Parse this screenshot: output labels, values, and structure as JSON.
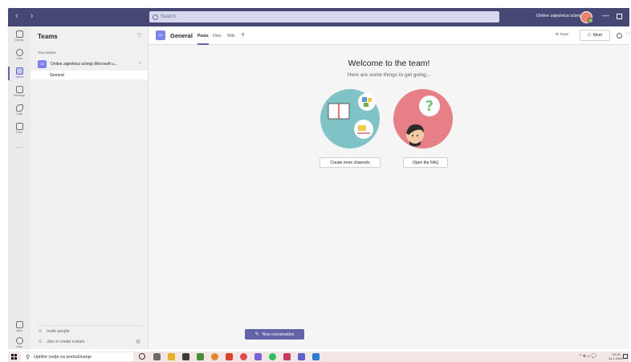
{
  "titlebar": {
    "nav": "‹ ›",
    "search_placeholder": "Search",
    "org_name": "Online zajednica učenja",
    "minimize": "—"
  },
  "rail": {
    "items": [
      {
        "label": "Activity",
        "icon": "bell-icon"
      },
      {
        "label": "Chat",
        "icon": "chat-icon"
      },
      {
        "label": "Teams",
        "icon": "teams-icon",
        "active": true
      },
      {
        "label": "Meetings",
        "icon": "calendar-icon"
      },
      {
        "label": "Calls",
        "icon": "phone-icon"
      },
      {
        "label": "Files",
        "icon": "file-icon"
      }
    ],
    "more": "···",
    "apps_label": "Apps",
    "help_label": "Help"
  },
  "teams_panel": {
    "title": "Teams",
    "section": "Your teams",
    "team": {
      "badge": "OZ",
      "name": "Online zajednica učenja Microsoft u..."
    },
    "channel": "General",
    "invite": "Invite people",
    "join": "Join or create a team"
  },
  "channel_header": {
    "badge": "OZ",
    "title": "General",
    "tabs": [
      "Posts",
      "Files",
      "Wiki"
    ],
    "add_tab": "+",
    "team_button": "Team",
    "meet_button": "Meet",
    "more": "···"
  },
  "main": {
    "welcome_title": "Welcome to the team!",
    "welcome_subtitle": "Here are some things to get going...",
    "create_channels_button": "Create more channels",
    "open_faq_button": "Open the FAQ",
    "new_conversation_button": "New conversation"
  },
  "taskbar": {
    "search_placeholder": "Upišite ovdje za pretraživanje",
    "tray": "^ ⊕ ♫ 💬",
    "clock_time": "20:15",
    "clock_date": "14.1.2021."
  },
  "colors": {
    "titlebar": "#464775",
    "accent": "#6264a7",
    "badge": "#7b83eb",
    "illustration_teal": "#7fc3c6",
    "illustration_pink": "#e77f86"
  }
}
